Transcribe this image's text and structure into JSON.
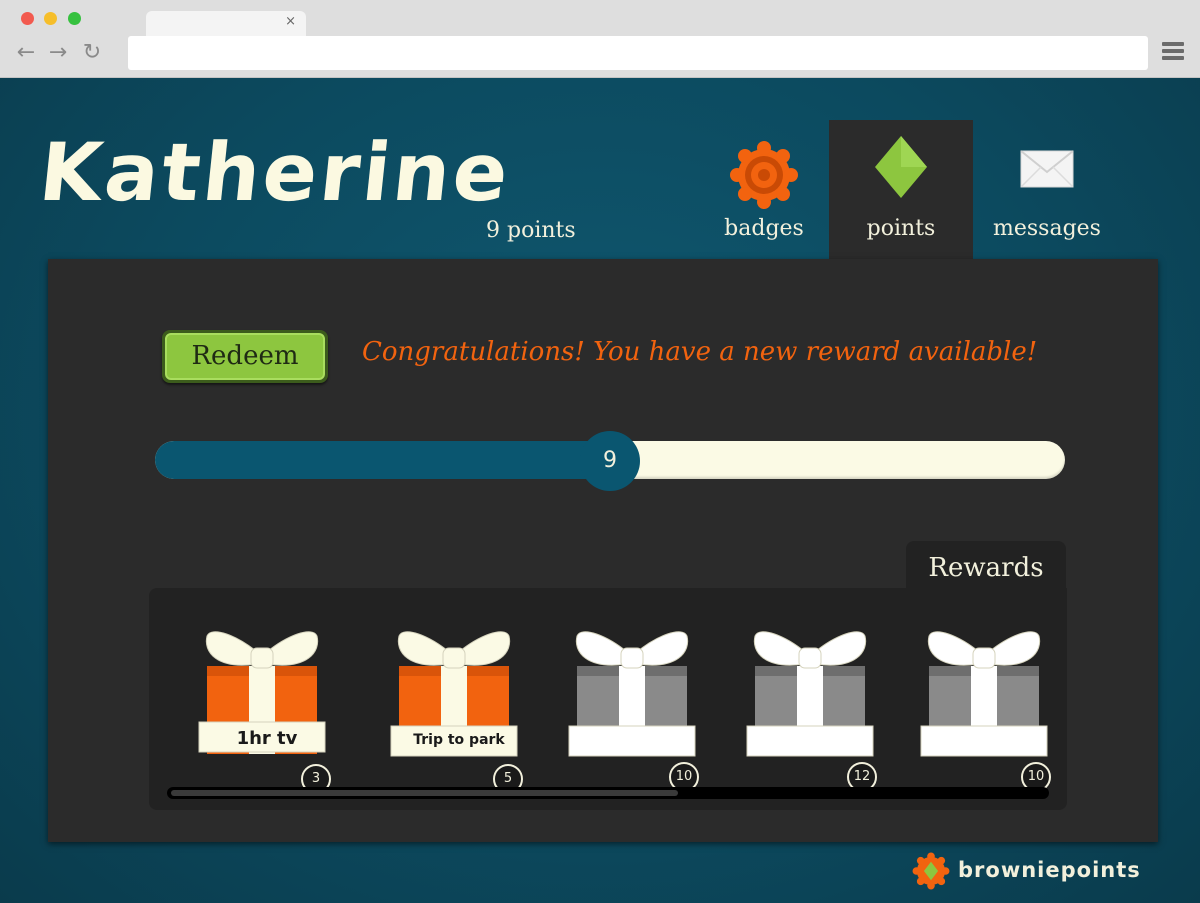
{
  "browser": {
    "tab_close": "×",
    "back_icon": "arrow-left",
    "forward_icon": "arrow-right",
    "reload_icon": "reload",
    "url": ""
  },
  "header": {
    "user_name": "Katherine",
    "points_label": "9 points"
  },
  "nav": {
    "tabs": [
      {
        "label": "badges",
        "icon": "badge-flower-icon",
        "active": false
      },
      {
        "label": "points",
        "icon": "green-diamond-icon",
        "active": true
      },
      {
        "label": "messages",
        "icon": "envelope-icon",
        "active": false
      }
    ]
  },
  "panel": {
    "redeem_label": "Redeem",
    "congrats_message": "Congratulations! You have a new reward available!",
    "slider": {
      "value": 9,
      "display": "9",
      "fraction": 0.5
    }
  },
  "rewards": {
    "title": "Rewards",
    "items": [
      {
        "label": "1hr tv",
        "cost": "3",
        "unlocked": true
      },
      {
        "label": "Trip to park",
        "cost": "5",
        "unlocked": true
      },
      {
        "label": "",
        "cost": "10",
        "unlocked": false
      },
      {
        "label": "",
        "cost": "12",
        "unlocked": false
      },
      {
        "label": "",
        "cost": "10",
        "unlocked": false
      }
    ],
    "scroll_fraction": 0.58
  },
  "brand": {
    "name": "browniepoints"
  },
  "colors": {
    "background": "#0c4a5f",
    "panel": "#2b2b2b",
    "accent_orange": "#f2630f",
    "accent_green": "#8dc63f",
    "slider_fill": "#0a5670",
    "cream": "#fbfae5",
    "locked_gray": "#8a8a8a"
  }
}
